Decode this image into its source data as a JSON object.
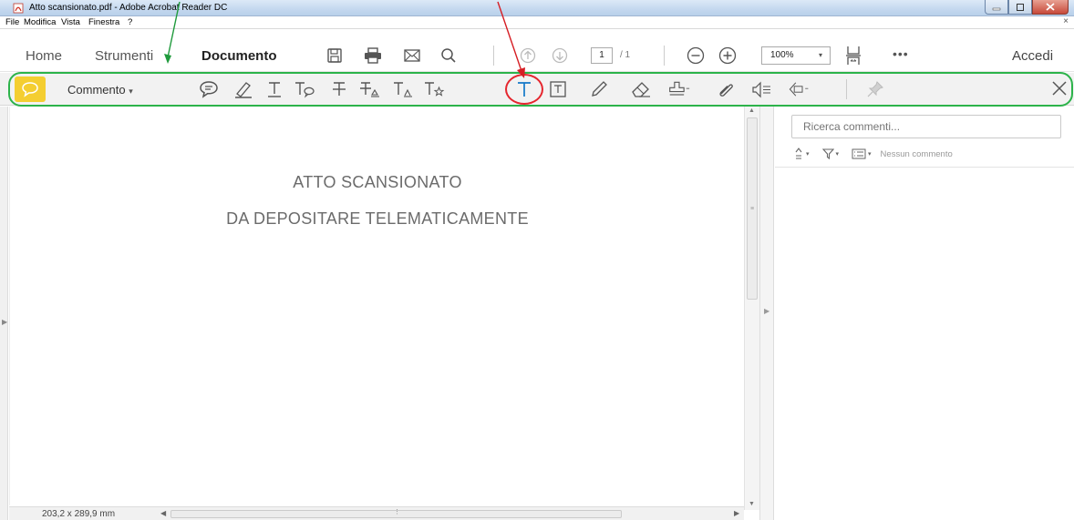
{
  "window": {
    "title": "Atto scansionato.pdf - Adobe Acrobat Reader DC"
  },
  "menubar": {
    "items": [
      "File",
      "Modifica",
      "Vista",
      "Finestra",
      "?"
    ],
    "close": "×"
  },
  "toolbar": {
    "home": "Home",
    "tools": "Strumenti",
    "document": "Documento",
    "page_current": "1",
    "page_total": "/ 1",
    "zoom": "100%",
    "zoom_caret": "▾",
    "more": "•••",
    "sign_in": "Accedi"
  },
  "comment_toolbar": {
    "label": "Commento",
    "dropdown": "▾",
    "highlight_color": "#f4ce31",
    "selected_tool": "add-text-comment",
    "annotation_circle_color": "#e5262e",
    "annotation_outline_color": "#2cb34a"
  },
  "document": {
    "lines": [
      "ATTO SCANSIONATO",
      "DA DEPOSITARE TELEMATICAMENTE"
    ],
    "page_size": "203,2 x 289,9 mm"
  },
  "comments_pane": {
    "search_placeholder": "Ricerca commenti...",
    "empty_text": "Nessun commento"
  },
  "colors": {
    "accent_blue": "#1478c8",
    "annotation_green": "#2cb34a",
    "annotation_red": "#e5262e"
  }
}
